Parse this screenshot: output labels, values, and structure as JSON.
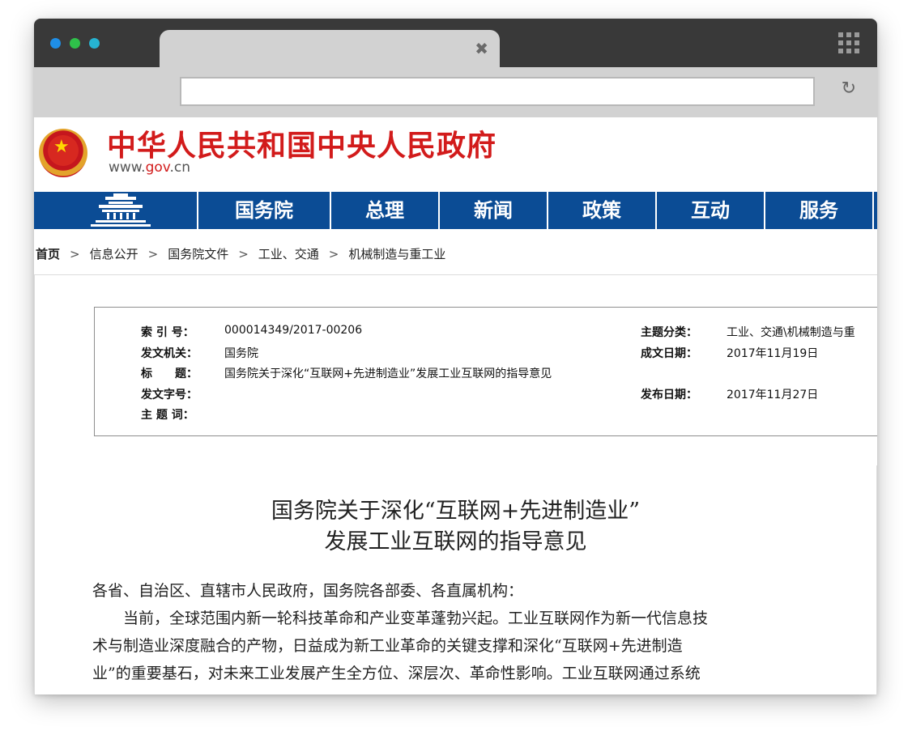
{
  "browser": {
    "dot_colors": [
      "#1f8fe8",
      "#2fc14a",
      "#26b3d1"
    ],
    "tab_close_glyph": "✖",
    "address_value": "",
    "reload_glyph": "↻"
  },
  "site": {
    "title": "中华人民共和国中央人民政府",
    "url_pre": "www.",
    "url_brand": "gov",
    "url_post": ".cn",
    "brand_color": "#d21b1b",
    "nav_color": "#0b4c95",
    "nav": [
      "国务院",
      "总理",
      "新闻",
      "政策",
      "互动",
      "服务"
    ]
  },
  "breadcrumb": [
    "首页",
    "信息公开",
    "国务院文件",
    "工业、交通",
    "机械制造与重工业"
  ],
  "breadcrumb_sep": ">",
  "meta": {
    "index_label": "索 引 号：",
    "index_value": "000014349/2017-00206",
    "topic_label": "主题分类：",
    "topic_value": "工业、交通\\机械制造与重",
    "issuer_label": "发文机关：",
    "issuer_value": "国务院",
    "created_label": "成文日期：",
    "created_value": "2017年11月19日",
    "title_label": "标　　题：",
    "title_value": "国务院关于深化“互联网+先进制造业”发展工业互联网的指导意见",
    "docno_label": "发文字号：",
    "docno_value": "",
    "published_label": "发布日期：",
    "published_value": "2017年11月27日",
    "keywords_label": "主 题 词：",
    "keywords_value": ""
  },
  "document": {
    "title_line1": "国务院关于深化“互联网+先进制造业”",
    "title_line2": "发展工业互联网的指导意见",
    "salutation": "各省、自治区、直辖市人民政府，国务院各部委、各直属机构：",
    "para1_line1": "当前，全球范围内新一轮科技革命和产业变革蓬勃兴起。工业互联网作为新一代信息技",
    "para1_line2": "术与制造业深度融合的产物，日益成为新工业革命的关键支撑和深化“互联网+先进制造",
    "para1_line3": "业”的重要基石，对未来工业发展产生全方位、深层次、革命性影响。工业互联网通过系统"
  }
}
